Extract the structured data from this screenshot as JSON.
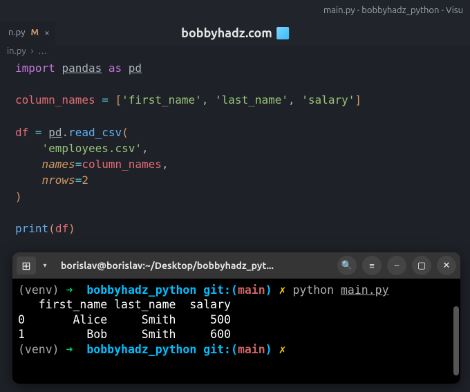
{
  "window": {
    "title": "main.py - bobbyhadz_python - Visu"
  },
  "watermark": {
    "text": "bobbyhadz.com"
  },
  "tab": {
    "name": "n.py",
    "status": "M",
    "close": "×"
  },
  "breadcrumb": {
    "file": "in.py",
    "sep": "›",
    "more": "…"
  },
  "code": {
    "l1_import": "import",
    "l1_pandas": "pandas",
    "l1_as": "as",
    "l1_pd": "pd",
    "l3_var": "column_names",
    "l3_eq": "=",
    "l3_s1": "'first_name'",
    "l3_s2": "'last_name'",
    "l3_s3": "'salary'",
    "l5_df": "df",
    "l5_eq": "=",
    "l5_pd": "pd",
    "l5_read": "read_csv",
    "l6_file": "'employees.csv'",
    "l7_names": "names",
    "l7_val": "column_names",
    "l8_nrows": "nrows",
    "l8_val": "2",
    "l11_print": "print",
    "l11_df": "df"
  },
  "terminal": {
    "title": "borislav@borislav:~/Desktop/bobbyhadz_pyt...",
    "venv": "(venv)",
    "arrow": "➜",
    "dir": "bobbyhadz_python",
    "git": "git:",
    "branch": "main",
    "x": "✗",
    "cmd_python": "python",
    "cmd_file": "main.py",
    "out_header": "   first_name last_name  salary",
    "out_row0": "0       Alice     Smith     500",
    "out_row1": "1         Bob     Smith     600",
    "icon_search": "🔍",
    "icon_menu": "≡",
    "icon_min": "–",
    "icon_max": "▢",
    "icon_close": "✕",
    "icon_newtab": "⊞",
    "icon_drop": "▾"
  }
}
